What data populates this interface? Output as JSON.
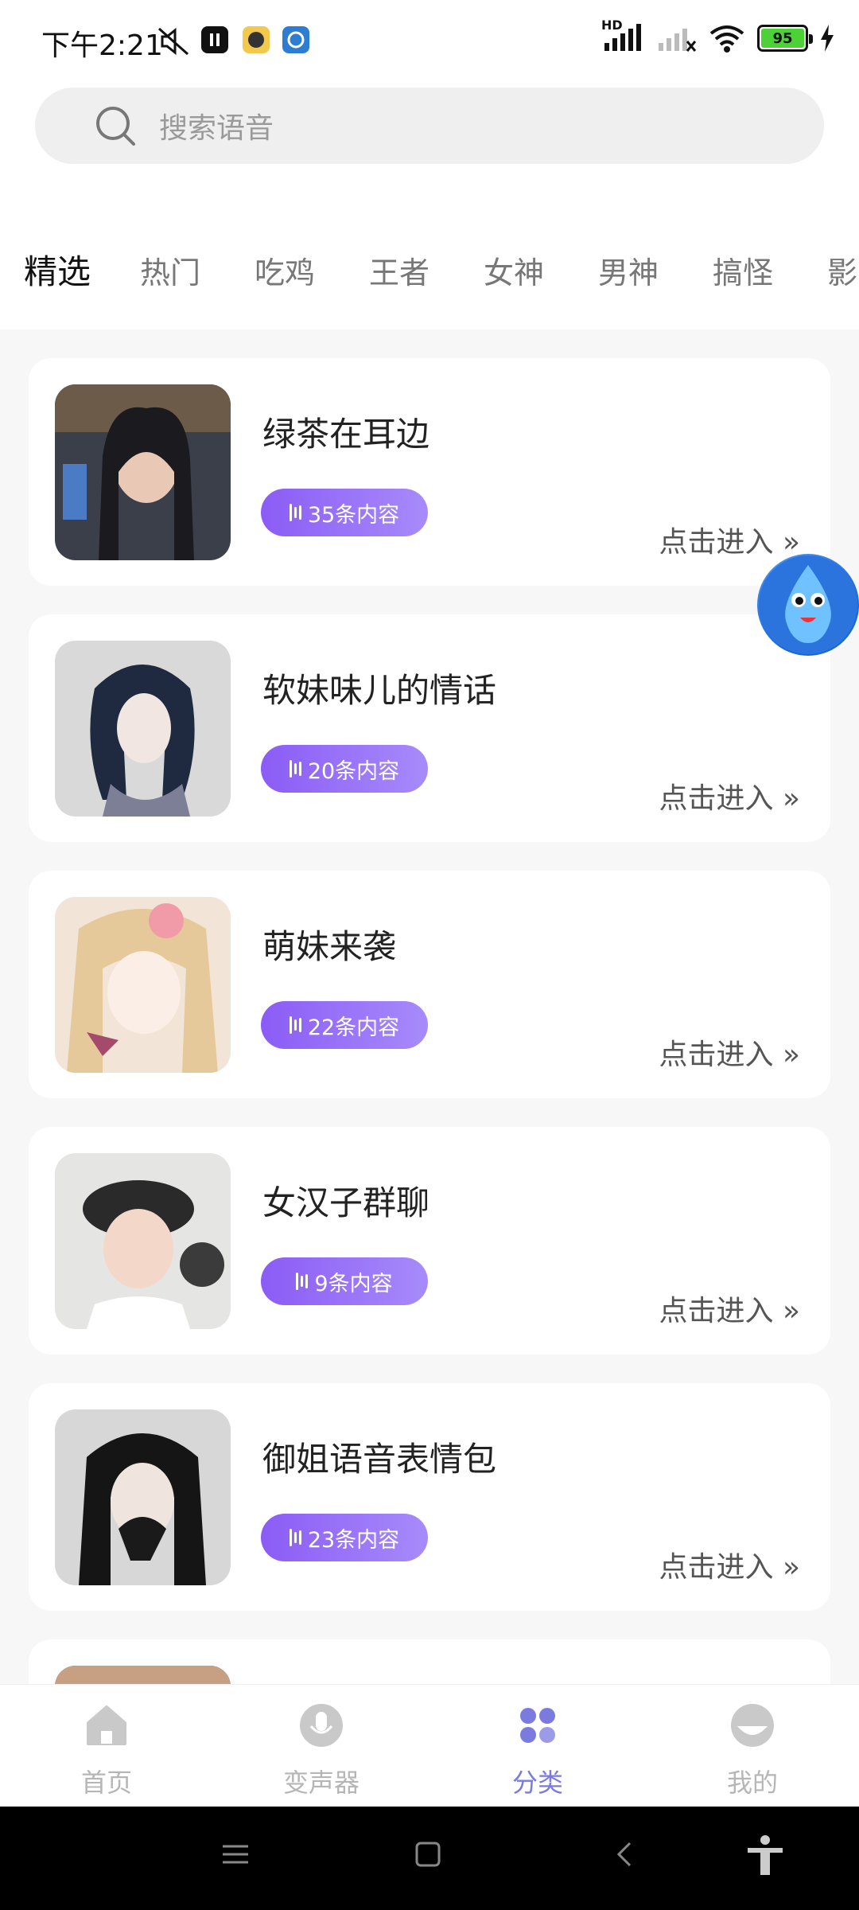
{
  "status_bar": {
    "time": "下午2:21",
    "network_label": "HD",
    "battery_level": "95"
  },
  "search": {
    "placeholder": "搜索语音"
  },
  "tabs": [
    {
      "label": "精选",
      "active": true
    },
    {
      "label": "热门"
    },
    {
      "label": "吃鸡"
    },
    {
      "label": "王者"
    },
    {
      "label": "女神"
    },
    {
      "label": "男神"
    },
    {
      "label": "搞怪"
    },
    {
      "label": "影"
    }
  ],
  "cards": [
    {
      "title": "绿茶在耳边",
      "count": "35条内容",
      "action": "点击进入"
    },
    {
      "title": "软妹味儿的情话",
      "count": "20条内容",
      "action": "点击进入"
    },
    {
      "title": "萌妹来袭",
      "count": "22条内容",
      "action": "点击进入"
    },
    {
      "title": "女汉子群聊",
      "count": "9条内容",
      "action": "点击进入"
    },
    {
      "title": "御姐语音表情包",
      "count": "23条内容",
      "action": "点击进入"
    }
  ],
  "nav": [
    {
      "label": "首页",
      "icon": "home-icon"
    },
    {
      "label": "变声器",
      "icon": "microphone-icon"
    },
    {
      "label": "分类",
      "icon": "category-icon",
      "active": true
    },
    {
      "label": "我的",
      "icon": "profile-icon"
    }
  ],
  "colors": {
    "accent": "#7a7adf",
    "badge_start": "#8b5cf6",
    "badge_end": "#a78bfa"
  }
}
